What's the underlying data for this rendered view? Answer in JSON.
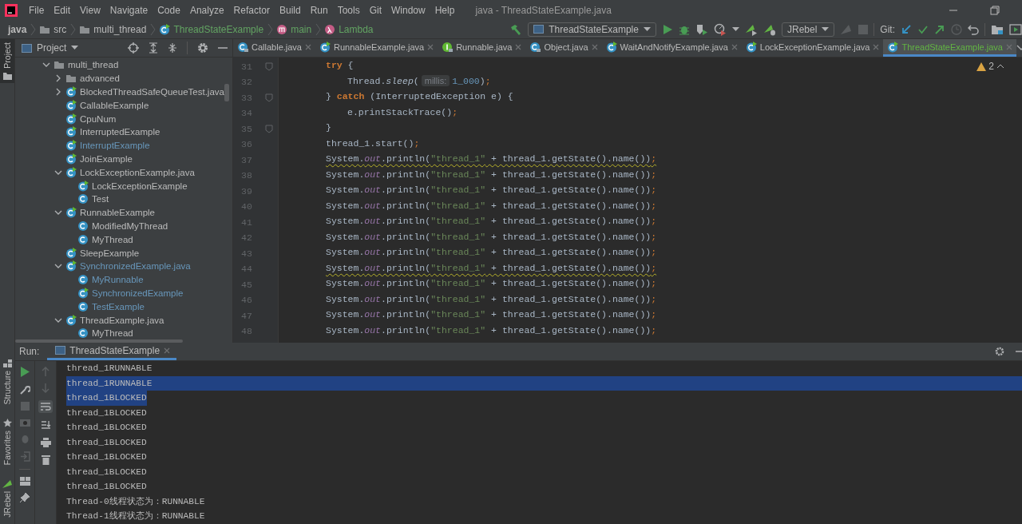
{
  "menu_bar": {
    "items": [
      "File",
      "Edit",
      "View",
      "Navigate",
      "Code",
      "Analyze",
      "Refactor",
      "Build",
      "Run",
      "Tools",
      "Git",
      "Window",
      "Help"
    ],
    "title": "java - ThreadStateExample.java"
  },
  "breadcrumbs": [
    {
      "label": "java",
      "kind": "root"
    },
    {
      "label": "src",
      "kind": "folder"
    },
    {
      "label": "multi_thread",
      "kind": "folder"
    },
    {
      "label": "ThreadStateExample",
      "kind": "class"
    },
    {
      "label": "main",
      "kind": "method"
    },
    {
      "label": "Lambda",
      "kind": "lambda"
    }
  ],
  "toolbar": {
    "run_configuration": "ThreadStateExample",
    "jrebel_configuration": "JRebel",
    "git_label": "Git:"
  },
  "tool_strip": {
    "top": [
      {
        "label": "Project",
        "selected": true
      }
    ],
    "bottom": [
      {
        "label": "Structure",
        "selected": false
      },
      {
        "label": "Favorites",
        "selected": false
      },
      {
        "label": "JRebel",
        "selected": false
      }
    ]
  },
  "project_panel": {
    "title": "Project",
    "tree": [
      {
        "label": "multi_thread",
        "kind": "folder",
        "color": "#bbbbbb",
        "expanded": true,
        "children": [
          {
            "label": "advanced",
            "kind": "folder",
            "color": "#bbbbbb",
            "expanded": false
          },
          {
            "label": "BlockedThreadSafeQueueTest.java",
            "kind": "runnable-class",
            "color": "#bbbbbb",
            "expanded": false
          },
          {
            "label": "CallableExample",
            "kind": "runnable-class",
            "color": "#bbbbbb"
          },
          {
            "label": "CpuNum",
            "kind": "runnable-class",
            "color": "#bbbbbb"
          },
          {
            "label": "InterruptedExample",
            "kind": "runnable-class",
            "color": "#bbbbbb"
          },
          {
            "label": "InterruptExample",
            "kind": "runnable-class",
            "color": "#6897bb"
          },
          {
            "label": "JoinExample",
            "kind": "runnable-class",
            "color": "#bbbbbb"
          },
          {
            "label": "LockExceptionExample.java",
            "kind": "runnable-class",
            "color": "#bbbbbb",
            "expanded": true,
            "children": [
              {
                "label": "LockExceptionExample",
                "kind": "runnable-class",
                "color": "#bbbbbb"
              },
              {
                "label": "Test",
                "kind": "class",
                "color": "#bbbbbb"
              }
            ]
          },
          {
            "label": "RunnableExample",
            "kind": "runnable-class",
            "color": "#bbbbbb",
            "expanded": true,
            "children": [
              {
                "label": "ModifiedMyThread",
                "kind": "class",
                "color": "#bbbbbb"
              },
              {
                "label": "MyThread",
                "kind": "class",
                "color": "#bbbbbb"
              }
            ]
          },
          {
            "label": "SleepExample",
            "kind": "runnable-class",
            "color": "#bbbbbb"
          },
          {
            "label": "SynchronizedExample.java",
            "kind": "runnable-class",
            "color": "#6897bb",
            "expanded": true,
            "children": [
              {
                "label": "MyRunnable",
                "kind": "class",
                "color": "#6897bb"
              },
              {
                "label": "SynchronizedExample",
                "kind": "runnable-class",
                "color": "#6897bb"
              },
              {
                "label": "TestExample",
                "kind": "class",
                "color": "#6897bb"
              }
            ]
          },
          {
            "label": "ThreadExample.java",
            "kind": "runnable-class",
            "color": "#bbbbbb",
            "expanded": true,
            "children": [
              {
                "label": "MyThread",
                "kind": "class",
                "color": "#bbbbbb"
              }
            ]
          }
        ]
      }
    ]
  },
  "editor": {
    "tabs": [
      {
        "label": "Callable.java",
        "kind": "library-class",
        "selected": false
      },
      {
        "label": "RunnableExample.java",
        "kind": "runnable-class",
        "selected": false
      },
      {
        "label": "Runnable.java",
        "kind": "interface",
        "selected": false
      },
      {
        "label": "Object.java",
        "kind": "library-class",
        "selected": false
      },
      {
        "label": "WaitAndNotifyExample.java",
        "kind": "runnable-class",
        "selected": false
      },
      {
        "label": "LockExceptionExample.java",
        "kind": "runnable-class",
        "selected": false
      },
      {
        "label": "ThreadStateExample.java",
        "kind": "runnable-class",
        "selected": true
      }
    ],
    "problems_count": "2",
    "lines": [
      {
        "number": "31",
        "kind": "outer",
        "fold_marker": true,
        "warning": false,
        "segments": [
          {
            "kind": "keyword",
            "text": "try"
          },
          {
            "kind": "plain",
            "text": " {"
          }
        ]
      },
      {
        "number": "32",
        "kind": "inner",
        "fold_marker": false,
        "warning": false,
        "segments": [
          {
            "kind": "plain",
            "text": "Thread."
          },
          {
            "kind": "static",
            "text": "sleep"
          },
          {
            "kind": "plain",
            "text": "("
          },
          {
            "kind": "hint",
            "text": "millis:"
          },
          {
            "kind": "number",
            "text": "1_000"
          },
          {
            "kind": "plain",
            "text": ")"
          },
          {
            "kind": "punct",
            "text": ";"
          }
        ]
      },
      {
        "number": "33",
        "kind": "outer",
        "fold_marker": true,
        "warning": false,
        "segments": [
          {
            "kind": "plain",
            "text": "} "
          },
          {
            "kind": "keyword",
            "text": "catch"
          },
          {
            "kind": "plain",
            "text": " (InterruptedException e) {"
          }
        ]
      },
      {
        "number": "34",
        "kind": "inner",
        "fold_marker": false,
        "warning": false,
        "segments": [
          {
            "kind": "plain",
            "text": "e.printStackTrace()"
          },
          {
            "kind": "punct",
            "text": ";"
          }
        ]
      },
      {
        "number": "35",
        "kind": "outer",
        "fold_marker": true,
        "warning": false,
        "segments": [
          {
            "kind": "plain",
            "text": "}"
          }
        ]
      },
      {
        "number": "36",
        "kind": "outer",
        "fold_marker": false,
        "warning": false,
        "segments": [
          {
            "kind": "plain",
            "text": "thread_1.start()"
          },
          {
            "kind": "punct",
            "text": ";"
          }
        ]
      },
      {
        "number": "37",
        "kind": "outer",
        "fold_marker": false,
        "warning": true,
        "segments": [
          {
            "kind": "plain",
            "text": "System."
          },
          {
            "kind": "field",
            "text": "out"
          },
          {
            "kind": "plain",
            "text": ".println("
          },
          {
            "kind": "string",
            "text": "\"thread_1\""
          },
          {
            "kind": "plain",
            "text": " + thread_1.getState().name())"
          },
          {
            "kind": "punct",
            "text": ";"
          }
        ]
      },
      {
        "number": "38",
        "kind": "outer",
        "fold_marker": false,
        "warning": false,
        "segments": [
          {
            "kind": "plain",
            "text": "System."
          },
          {
            "kind": "field",
            "text": "out"
          },
          {
            "kind": "plain",
            "text": ".println("
          },
          {
            "kind": "string",
            "text": "\"thread_1\""
          },
          {
            "kind": "plain",
            "text": " + thread_1.getState().name())"
          },
          {
            "kind": "punct",
            "text": ";"
          }
        ]
      },
      {
        "number": "39",
        "kind": "outer",
        "fold_marker": false,
        "warning": false,
        "segments": [
          {
            "kind": "plain",
            "text": "System."
          },
          {
            "kind": "field",
            "text": "out"
          },
          {
            "kind": "plain",
            "text": ".println("
          },
          {
            "kind": "string",
            "text": "\"thread_1\""
          },
          {
            "kind": "plain",
            "text": " + thread_1.getState().name())"
          },
          {
            "kind": "punct",
            "text": ";"
          }
        ]
      },
      {
        "number": "40",
        "kind": "outer",
        "fold_marker": false,
        "warning": false,
        "segments": [
          {
            "kind": "plain",
            "text": "System."
          },
          {
            "kind": "field",
            "text": "out"
          },
          {
            "kind": "plain",
            "text": ".println("
          },
          {
            "kind": "string",
            "text": "\"thread_1\""
          },
          {
            "kind": "plain",
            "text": " + thread_1.getState().name())"
          },
          {
            "kind": "punct",
            "text": ";"
          }
        ]
      },
      {
        "number": "41",
        "kind": "outer",
        "fold_marker": false,
        "warning": false,
        "segments": [
          {
            "kind": "plain",
            "text": "System."
          },
          {
            "kind": "field",
            "text": "out"
          },
          {
            "kind": "plain",
            "text": ".println("
          },
          {
            "kind": "string",
            "text": "\"thread_1\""
          },
          {
            "kind": "plain",
            "text": " + thread_1.getState().name())"
          },
          {
            "kind": "punct",
            "text": ";"
          }
        ]
      },
      {
        "number": "42",
        "kind": "outer",
        "fold_marker": false,
        "warning": false,
        "segments": [
          {
            "kind": "plain",
            "text": "System."
          },
          {
            "kind": "field",
            "text": "out"
          },
          {
            "kind": "plain",
            "text": ".println("
          },
          {
            "kind": "string",
            "text": "\"thread_1\""
          },
          {
            "kind": "plain",
            "text": " + thread_1.getState().name())"
          },
          {
            "kind": "punct",
            "text": ";"
          }
        ]
      },
      {
        "number": "43",
        "kind": "outer",
        "fold_marker": false,
        "warning": false,
        "segments": [
          {
            "kind": "plain",
            "text": "System."
          },
          {
            "kind": "field",
            "text": "out"
          },
          {
            "kind": "plain",
            "text": ".println("
          },
          {
            "kind": "string",
            "text": "\"thread_1\""
          },
          {
            "kind": "plain",
            "text": " + thread_1.getState().name())"
          },
          {
            "kind": "punct",
            "text": ";"
          }
        ]
      },
      {
        "number": "44",
        "kind": "outer",
        "fold_marker": false,
        "warning": true,
        "segments": [
          {
            "kind": "plain",
            "text": "System."
          },
          {
            "kind": "field",
            "text": "out"
          },
          {
            "kind": "plain",
            "text": ".println("
          },
          {
            "kind": "string",
            "text": "\"thread_1\""
          },
          {
            "kind": "plain",
            "text": " + thread_1.getState().name())"
          },
          {
            "kind": "punct",
            "text": ";"
          }
        ]
      },
      {
        "number": "45",
        "kind": "outer",
        "fold_marker": false,
        "warning": false,
        "segments": [
          {
            "kind": "plain",
            "text": "System."
          },
          {
            "kind": "field",
            "text": "out"
          },
          {
            "kind": "plain",
            "text": ".println("
          },
          {
            "kind": "string",
            "text": "\"thread_1\""
          },
          {
            "kind": "plain",
            "text": " + thread_1.getState().name())"
          },
          {
            "kind": "punct",
            "text": ";"
          }
        ]
      },
      {
        "number": "46",
        "kind": "outer",
        "fold_marker": false,
        "warning": false,
        "segments": [
          {
            "kind": "plain",
            "text": "System."
          },
          {
            "kind": "field",
            "text": "out"
          },
          {
            "kind": "plain",
            "text": ".println("
          },
          {
            "kind": "string",
            "text": "\"thread_1\""
          },
          {
            "kind": "plain",
            "text": " + thread_1.getState().name())"
          },
          {
            "kind": "punct",
            "text": ";"
          }
        ]
      },
      {
        "number": "47",
        "kind": "outer",
        "fold_marker": false,
        "warning": false,
        "segments": [
          {
            "kind": "plain",
            "text": "System."
          },
          {
            "kind": "field",
            "text": "out"
          },
          {
            "kind": "plain",
            "text": ".println("
          },
          {
            "kind": "string",
            "text": "\"thread_1\""
          },
          {
            "kind": "plain",
            "text": " + thread_1.getState().name())"
          },
          {
            "kind": "punct",
            "text": ";"
          }
        ]
      },
      {
        "number": "48",
        "kind": "outer",
        "fold_marker": false,
        "warning": false,
        "segments": [
          {
            "kind": "plain",
            "text": "System."
          },
          {
            "kind": "field",
            "text": "out"
          },
          {
            "kind": "plain",
            "text": ".println("
          },
          {
            "kind": "string",
            "text": "\"thread_1\""
          },
          {
            "kind": "plain",
            "text": " + thread_1.getState().name())"
          },
          {
            "kind": "punct",
            "text": ";"
          }
        ]
      }
    ]
  },
  "run_panel": {
    "label": "Run:",
    "tab": "ThreadStateExample",
    "console": [
      {
        "text": "thread_1RUNNABLE",
        "selected": false,
        "line_end_selected": false
      },
      {
        "text": "thread_1RUNNABLE",
        "selected": true,
        "line_end_selected": true
      },
      {
        "text": "thread_1BLOCKED",
        "selected": true,
        "line_end_selected": false
      },
      {
        "text": "thread_1BLOCKED",
        "selected": false,
        "line_end_selected": false
      },
      {
        "text": "thread_1BLOCKED",
        "selected": false,
        "line_end_selected": false
      },
      {
        "text": "thread_1BLOCKED",
        "selected": false,
        "line_end_selected": false
      },
      {
        "text": "thread_1BLOCKED",
        "selected": false,
        "line_end_selected": false
      },
      {
        "text": "thread_1BLOCKED",
        "selected": false,
        "line_end_selected": false
      },
      {
        "text": "thread_1BLOCKED",
        "selected": false,
        "line_end_selected": false
      },
      {
        "text": "Thread-0线程状态为：RUNNABLE",
        "selected": false,
        "line_end_selected": false
      },
      {
        "text": "Thread-1线程状态为：RUNNABLE",
        "selected": false,
        "line_end_selected": false
      }
    ]
  }
}
